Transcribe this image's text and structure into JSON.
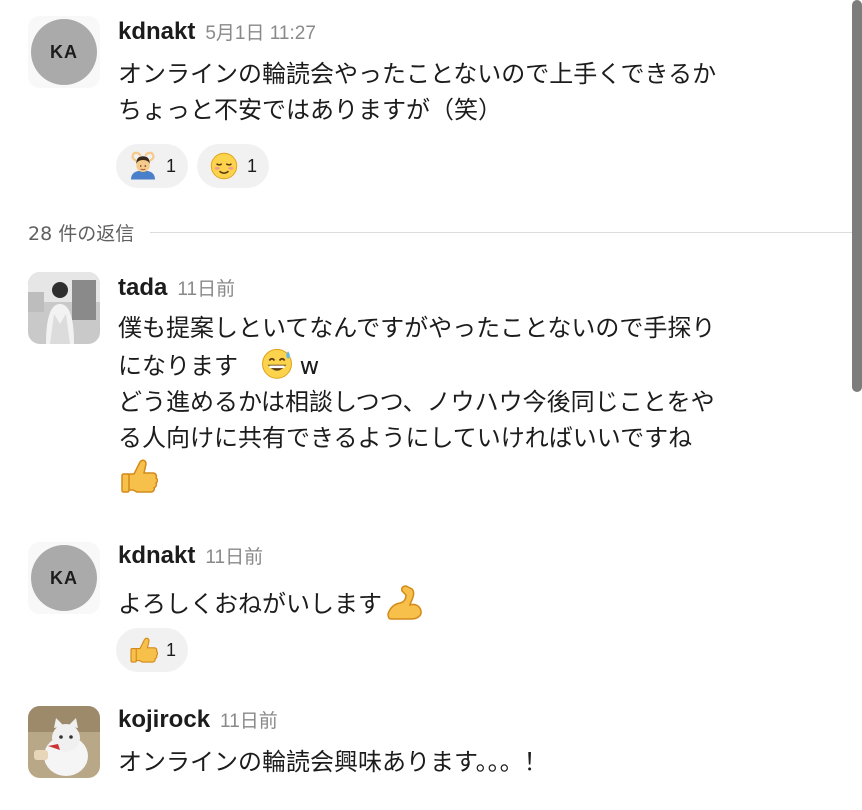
{
  "messages": [
    {
      "author": "kdnakt",
      "avatar_initials": "KA",
      "time": "5月1日 11:27",
      "lines": [
        "オンラインの輪読会やったことないので上手くできるか",
        "ちょっと不安ではありますが（笑）"
      ],
      "reactions": [
        {
          "emoji": "person-gesturing-ok-emoji",
          "count": "1"
        },
        {
          "emoji": "relaxed-face-emoji",
          "count": "1"
        }
      ]
    },
    {
      "author": "tada",
      "avatar_type": "photo",
      "time": "11日前",
      "lines": [
        "僕も提案しといてなんですがやったことないので手探り",
        "になります",
        "w",
        "どう進めるかは相談しつつ、ノウハウ今後同じことをや",
        "る人向けに共有できるようにしていければいいですね"
      ],
      "inline_emojis": [
        "grinning-sweat-emoji",
        "thumbs-up-emoji"
      ]
    },
    {
      "author": "kdnakt",
      "avatar_initials": "KA",
      "time": "11日前",
      "lines": [
        "よろしくおねがいします"
      ],
      "inline_emojis": [
        "flexed-biceps-emoji"
      ],
      "reactions": [
        {
          "emoji": "thumbs-up-emoji",
          "count": "1"
        }
      ]
    },
    {
      "author": "kojirock",
      "avatar_type": "photo",
      "time": "11日前",
      "lines": [
        "オンラインの輪読会興味あります。。。！"
      ]
    }
  ],
  "thread": {
    "replies_label": "28 件の返信"
  },
  "colors": {
    "timestamp": "#8a898a",
    "reaction_bg": "#f1f1f1",
    "avatar_gray": "#aaaaaa"
  }
}
